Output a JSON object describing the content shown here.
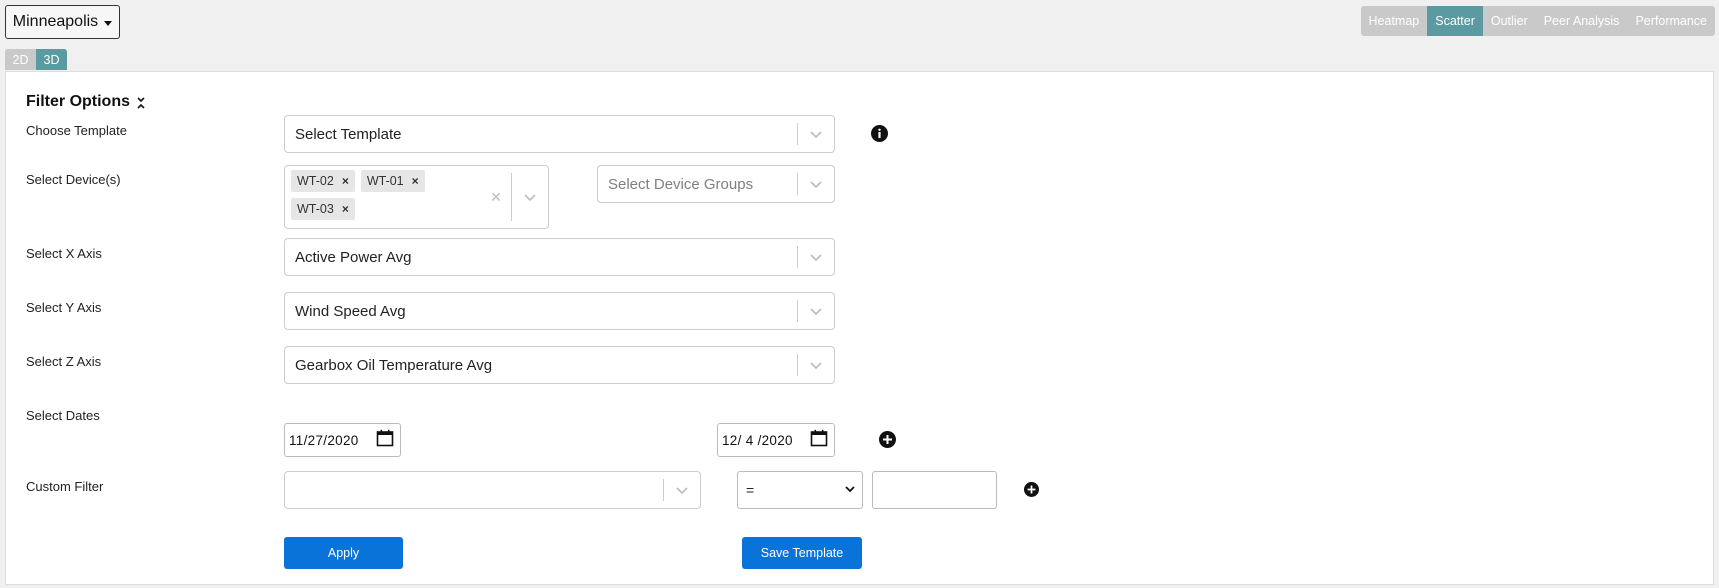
{
  "location": {
    "label": "Minneapolis"
  },
  "view_tabs": [
    {
      "label": "Heatmap",
      "active": false
    },
    {
      "label": "Scatter",
      "active": true
    },
    {
      "label": "Outlier",
      "active": false
    },
    {
      "label": "Peer Analysis",
      "active": false
    },
    {
      "label": "Performance",
      "active": false
    }
  ],
  "dim_tabs": [
    {
      "label": "2D",
      "active": false
    },
    {
      "label": "3D",
      "active": true
    }
  ],
  "filter": {
    "title": "Filter Options",
    "template": {
      "label": "Choose Template",
      "value": "Select Template"
    },
    "devices": {
      "label": "Select Device(s)",
      "chips": [
        "WT-02",
        "WT-01",
        "WT-03"
      ],
      "remove_glyph": "×",
      "clear_glyph": "×",
      "groups_placeholder": "Select Device Groups"
    },
    "x_axis": {
      "label": "Select X Axis",
      "value": "Active Power Avg"
    },
    "y_axis": {
      "label": "Select Y Axis",
      "value": "Wind Speed Avg"
    },
    "z_axis": {
      "label": "Select Z Axis",
      "value": "Gearbox Oil Temperature Avg"
    },
    "dates": {
      "label": "Select Dates",
      "start": "11/27/2020",
      "end": "12/ 4 /2020"
    },
    "custom": {
      "label": "Custom Filter",
      "field_value": "",
      "operator": "=",
      "value": ""
    },
    "apply_label": "Apply",
    "save_label": "Save Template"
  },
  "colors": {
    "accent": "#5b9aa0",
    "primary_button": "#0a73d9",
    "tab_inactive": "#c9c9c9"
  }
}
